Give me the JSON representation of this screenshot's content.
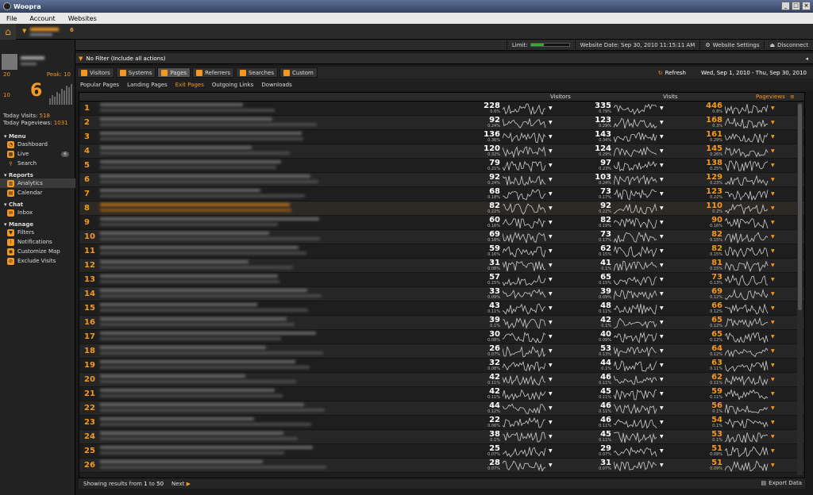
{
  "window": {
    "title": "Woopra"
  },
  "menu": [
    "File",
    "Account",
    "Websites"
  ],
  "site": {
    "count": "6"
  },
  "status": {
    "limit_label": "Limit:",
    "limit_used": 0.35,
    "website_date": "Website Date: Sep 30, 2010 11:15:11 AM",
    "settings": "Website Settings",
    "disconnect": "Disconnect"
  },
  "sidebar": {
    "range_low": "20",
    "peak": "Peak: 10",
    "range_mid": "10",
    "live_count": "6",
    "today_visits_label": "Today Visits:",
    "today_visits": "518",
    "today_pageviews_label": "Today Pageviews:",
    "today_pageviews": "1031",
    "menu_title": "Menu",
    "dashboard": "Dashboard",
    "live": "Live",
    "live_badge": "6",
    "search": "Search",
    "reports_title": "Reports",
    "analytics": "Analytics",
    "calendar": "Calendar",
    "chat_title": "Chat",
    "inbox": "Inbox",
    "manage_title": "Manage",
    "filters": "Filters",
    "notifications": "Notifications",
    "customize_map": "Customize Map",
    "exclude_visits": "Exclude Visits"
  },
  "filter": {
    "label": "No Filter (Include all actions)"
  },
  "tabs": [
    "Visitors",
    "Systems",
    "Pages",
    "Referrers",
    "Searches",
    "Custom"
  ],
  "refresh": "Refresh",
  "date_range": "Wed, Sep 1, 2010 - Thu, Sep 30, 2010",
  "subtabs": [
    "Popular Pages",
    "Landing Pages",
    "Exit Pages",
    "Outgoing Links",
    "Downloads"
  ],
  "columns": {
    "visitors": "Visitors",
    "visits": "Visits",
    "pageviews": "Pageviews"
  },
  "rows": [
    {
      "n": "1",
      "vi": "228",
      "vip": "0.6%",
      "vs": "335",
      "vsp": "0.79%",
      "pv": "446",
      "pvp": "0.8%"
    },
    {
      "n": "2",
      "vi": "92",
      "vip": "0.24%",
      "vs": "123",
      "vsp": "0.29%",
      "pv": "168",
      "pvp": "0.3%"
    },
    {
      "n": "3",
      "vi": "136",
      "vip": "0.36%",
      "vs": "143",
      "vsp": "0.34%",
      "pv": "161",
      "pvp": "0.29%"
    },
    {
      "n": "4",
      "vi": "120",
      "vip": "0.32%",
      "vs": "124",
      "vsp": "0.29%",
      "pv": "145",
      "pvp": "0.26%"
    },
    {
      "n": "5",
      "vi": "79",
      "vip": "0.21%",
      "vs": "97",
      "vsp": "0.23%",
      "pv": "138",
      "pvp": "0.25%"
    },
    {
      "n": "6",
      "vi": "92",
      "vip": "0.24%",
      "vs": "103",
      "vsp": "0.24%",
      "pv": "129",
      "pvp": "0.23%"
    },
    {
      "n": "7",
      "vi": "68",
      "vip": "0.18%",
      "vs": "73",
      "vsp": "0.17%",
      "pv": "123",
      "pvp": "0.22%"
    },
    {
      "n": "8",
      "vi": "82",
      "vip": "0.22%",
      "vs": "92",
      "vsp": "0.22%",
      "pv": "110",
      "pvp": "0.2%"
    },
    {
      "n": "9",
      "vi": "60",
      "vip": "0.16%",
      "vs": "82",
      "vsp": "0.19%",
      "pv": "90",
      "pvp": "0.16%"
    },
    {
      "n": "10",
      "vi": "69",
      "vip": "0.18%",
      "vs": "73",
      "vsp": "0.17%",
      "pv": "82",
      "pvp": "0.15%"
    },
    {
      "n": "11",
      "vi": "59",
      "vip": "0.16%",
      "vs": "62",
      "vsp": "0.15%",
      "pv": "82",
      "pvp": "0.15%"
    },
    {
      "n": "12",
      "vi": "31",
      "vip": "0.08%",
      "vs": "41",
      "vsp": "0.1%",
      "pv": "81",
      "pvp": "0.15%"
    },
    {
      "n": "13",
      "vi": "57",
      "vip": "0.15%",
      "vs": "65",
      "vsp": "0.15%",
      "pv": "73",
      "pvp": "0.13%"
    },
    {
      "n": "14",
      "vi": "33",
      "vip": "0.09%",
      "vs": "39",
      "vsp": "0.09%",
      "pv": "69",
      "pvp": "0.12%"
    },
    {
      "n": "15",
      "vi": "43",
      "vip": "0.11%",
      "vs": "48",
      "vsp": "0.11%",
      "pv": "66",
      "pvp": "0.12%"
    },
    {
      "n": "16",
      "vi": "39",
      "vip": "0.1%",
      "vs": "42",
      "vsp": "0.1%",
      "pv": "65",
      "pvp": "0.12%"
    },
    {
      "n": "17",
      "vi": "30",
      "vip": "0.08%",
      "vs": "40",
      "vsp": "0.09%",
      "pv": "65",
      "pvp": "0.12%"
    },
    {
      "n": "18",
      "vi": "26",
      "vip": "0.07%",
      "vs": "53",
      "vsp": "0.13%",
      "pv": "64",
      "pvp": "0.12%"
    },
    {
      "n": "19",
      "vi": "32",
      "vip": "0.08%",
      "vs": "44",
      "vsp": "0.1%",
      "pv": "63",
      "pvp": "0.11%"
    },
    {
      "n": "20",
      "vi": "42",
      "vip": "0.11%",
      "vs": "46",
      "vsp": "0.11%",
      "pv": "62",
      "pvp": "0.11%"
    },
    {
      "n": "21",
      "vi": "42",
      "vip": "0.11%",
      "vs": "45",
      "vsp": "0.11%",
      "pv": "59",
      "pvp": "0.11%"
    },
    {
      "n": "22",
      "vi": "44",
      "vip": "0.12%",
      "vs": "46",
      "vsp": "0.11%",
      "pv": "56",
      "pvp": "0.1%"
    },
    {
      "n": "23",
      "vi": "22",
      "vip": "0.06%",
      "vs": "46",
      "vsp": "0.11%",
      "pv": "54",
      "pvp": "0.1%"
    },
    {
      "n": "24",
      "vi": "38",
      "vip": "0.1%",
      "vs": "45",
      "vsp": "0.11%",
      "pv": "53",
      "pvp": "0.1%"
    },
    {
      "n": "25",
      "vi": "25",
      "vip": "0.07%",
      "vs": "29",
      "vsp": "0.07%",
      "pv": "51",
      "pvp": "0.09%"
    },
    {
      "n": "26",
      "vi": "28",
      "vip": "0.07%",
      "vs": "31",
      "vsp": "0.07%",
      "pv": "51",
      "pvp": "0.09%"
    }
  ],
  "footer": {
    "showing": "Showing results from",
    "from": "1",
    "to_word": "to",
    "to": "50",
    "next": "Next",
    "export": "Export Data"
  },
  "colors": {
    "accent": "#f39820",
    "limit": "#1cba2a"
  }
}
